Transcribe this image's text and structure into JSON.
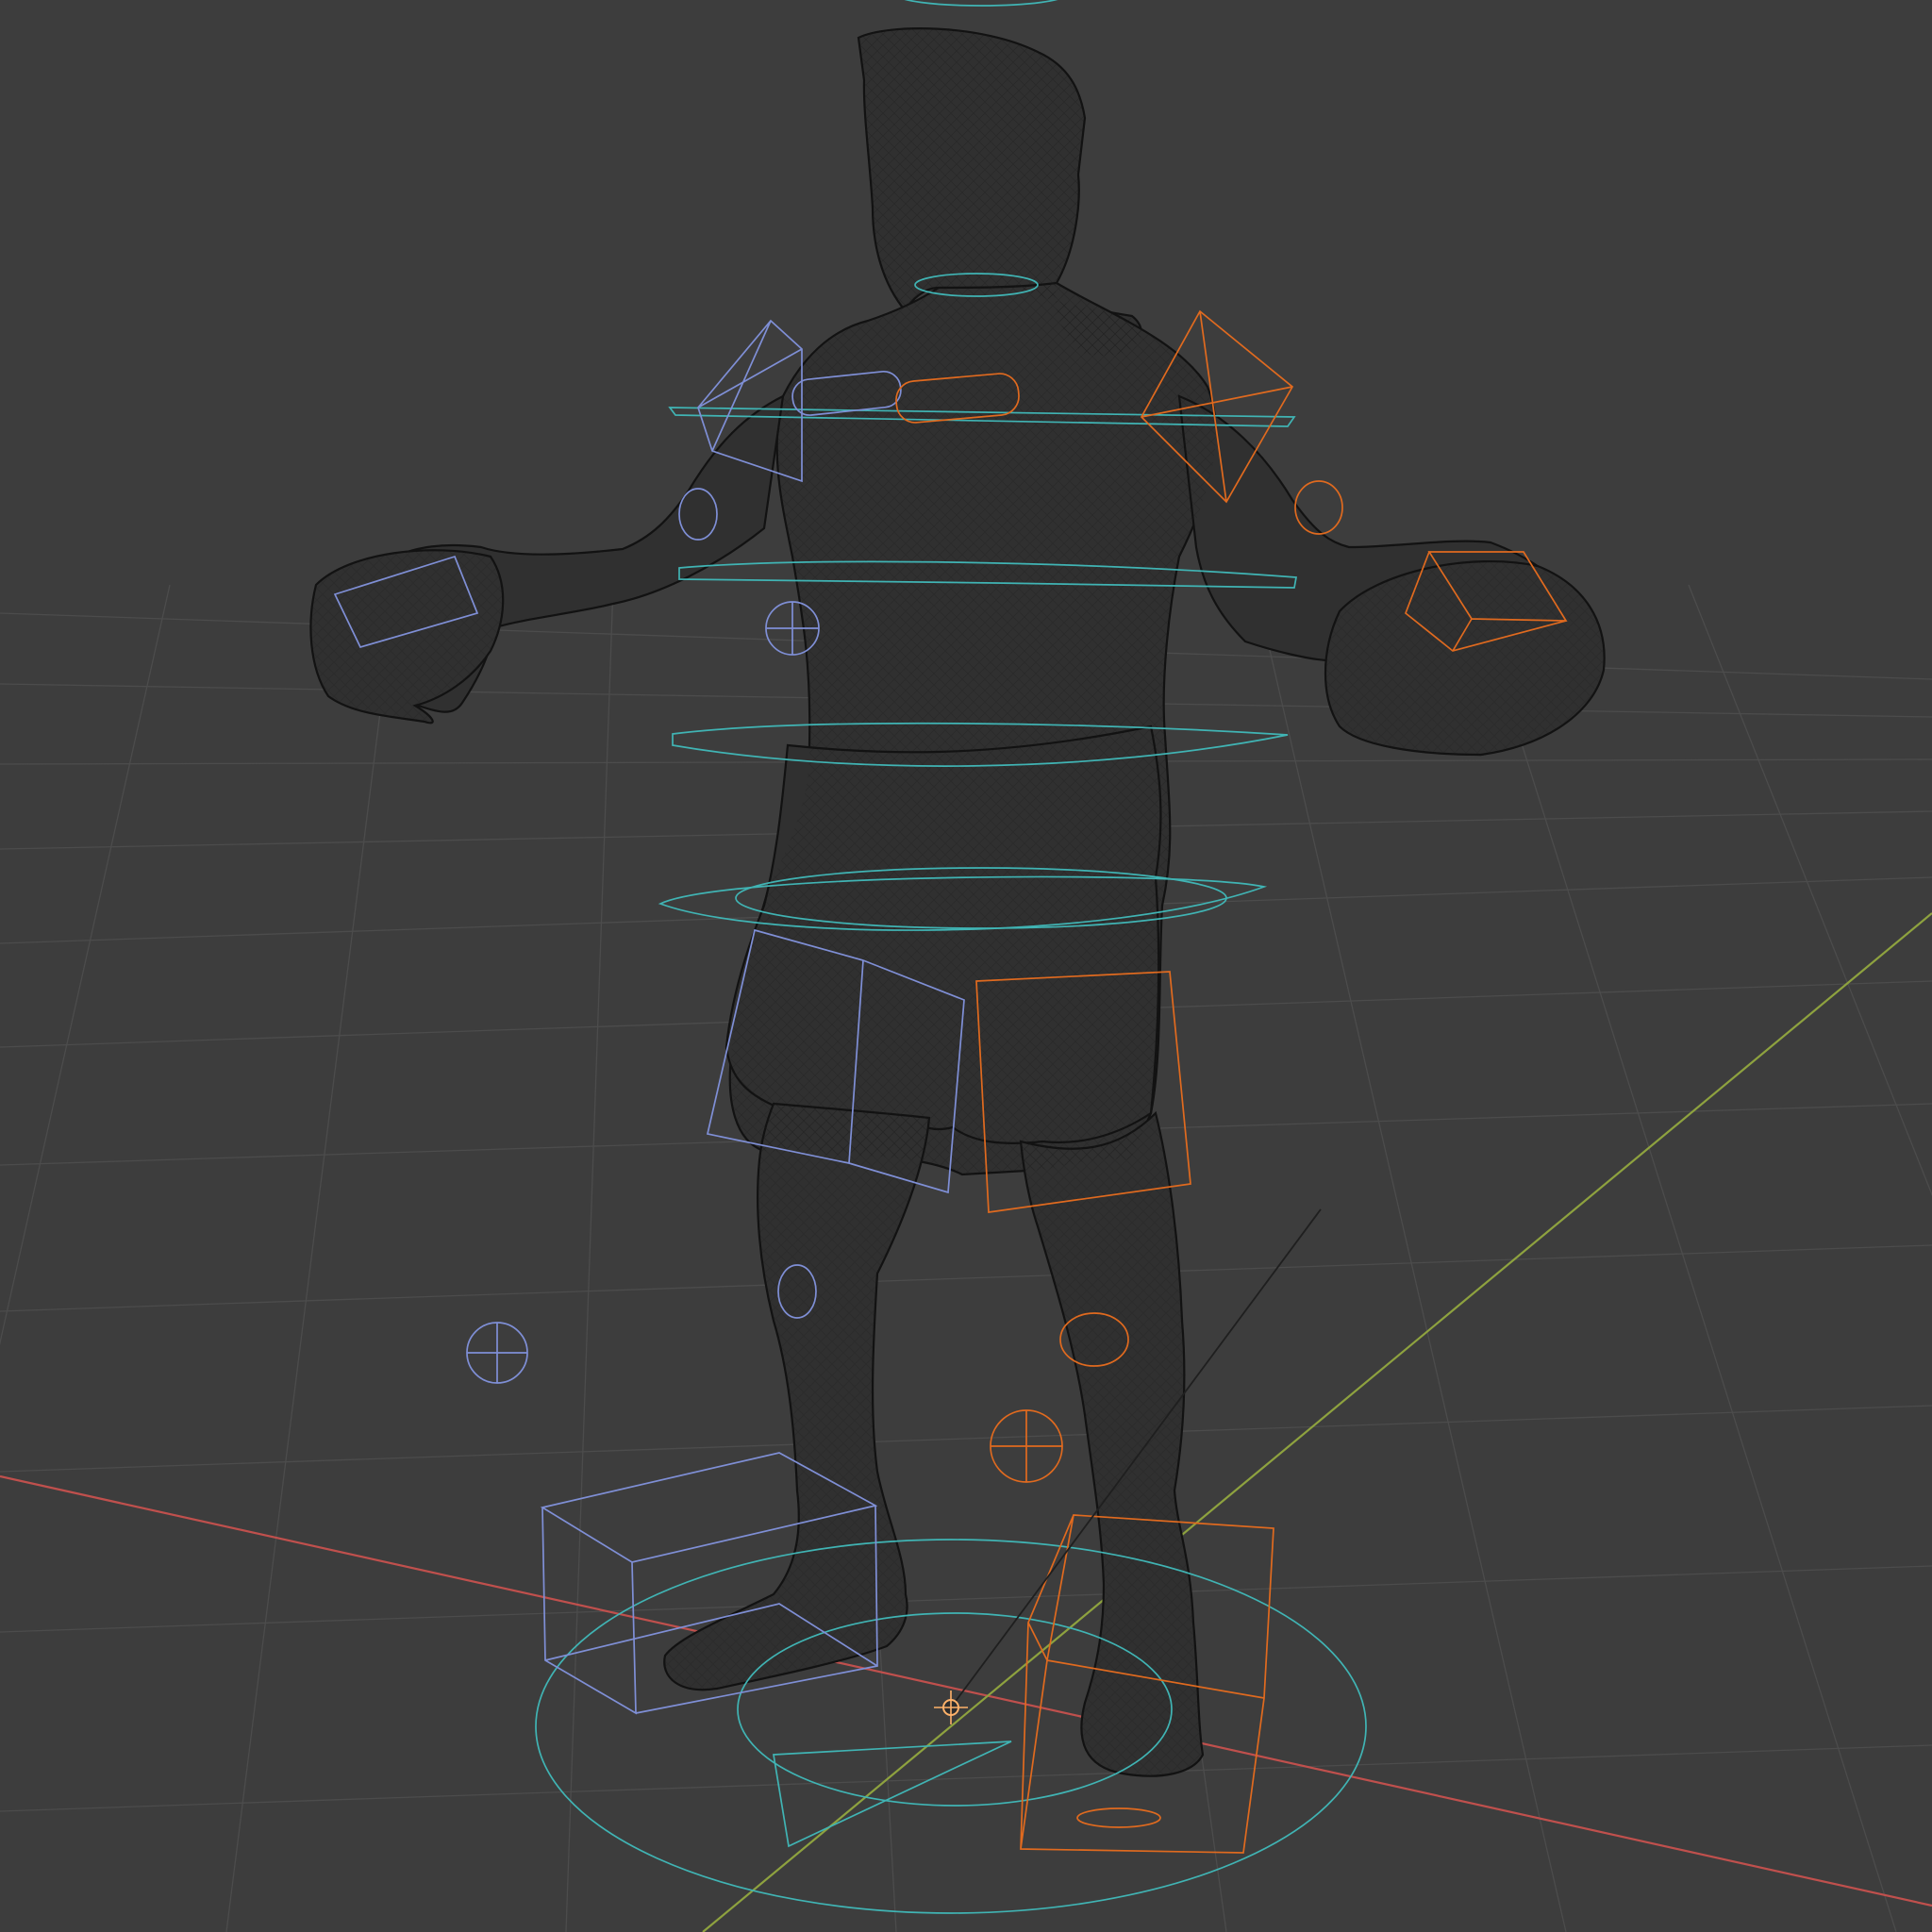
{
  "viewport": {
    "name": "3D Viewport",
    "shading": "wireframe",
    "background_color": "#3d3d3d",
    "grid_color": "#4c4c4c"
  },
  "axes": {
    "x_color": "#c0504d",
    "y_color": "#8ea23f"
  },
  "mesh": {
    "subject": "boxer-character",
    "wire_color": "#121212",
    "fill_color": "#303030"
  },
  "rig": {
    "center_controls_color": "#40b4b4",
    "left_controls_color": "#7f8fd6",
    "right_controls_color": "#e06a1f"
  },
  "origin_marker_color": "#ffb26a"
}
